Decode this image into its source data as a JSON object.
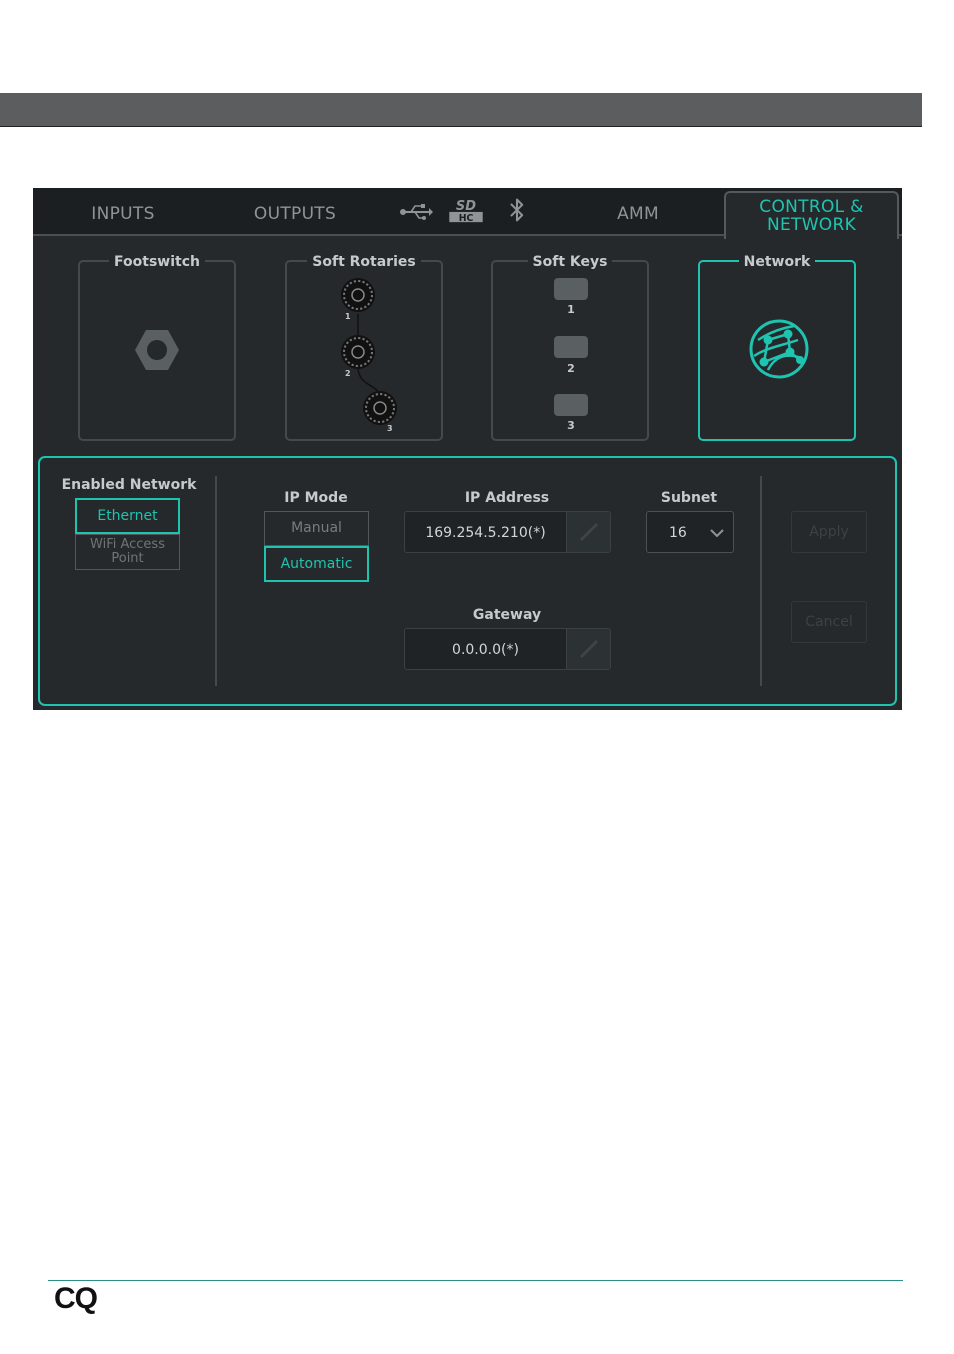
{
  "tabs": {
    "inputs": "INPUTS",
    "outputs": "OUTPUTS",
    "amm": "AMM",
    "control_line1": "CONTROL &",
    "control_line2": "NETWORK",
    "icons": [
      "usb-icon",
      "sd-hc-icon",
      "bluetooth-icon"
    ]
  },
  "panels": {
    "footswitch": "Footswitch",
    "soft_rotaries": "Soft Rotaries",
    "rotary_numbers": [
      "1",
      "2",
      "3"
    ],
    "soft_keys": "Soft Keys",
    "key_numbers": [
      "1",
      "2",
      "3"
    ],
    "network": "Network"
  },
  "network": {
    "enabled_title": "Enabled Network",
    "ethernet": "Ethernet",
    "wifi_line1": "WiFi Access",
    "wifi_line2": "Point",
    "ip_mode_title": "IP Mode",
    "manual": "Manual",
    "automatic": "Automatic",
    "ip_address_title": "IP Address",
    "ip_address": "169.254.5.210(*)",
    "subnet_title": "Subnet",
    "subnet": "16",
    "gateway_title": "Gateway",
    "gateway": "0.0.0.0(*)",
    "apply": "Apply",
    "cancel": "Cancel"
  },
  "footer": {
    "logo": "CQ"
  },
  "colors": {
    "accent": "#1fc4b0",
    "screen_bg": "#25292b",
    "header_bar": "#5b5d5f"
  }
}
